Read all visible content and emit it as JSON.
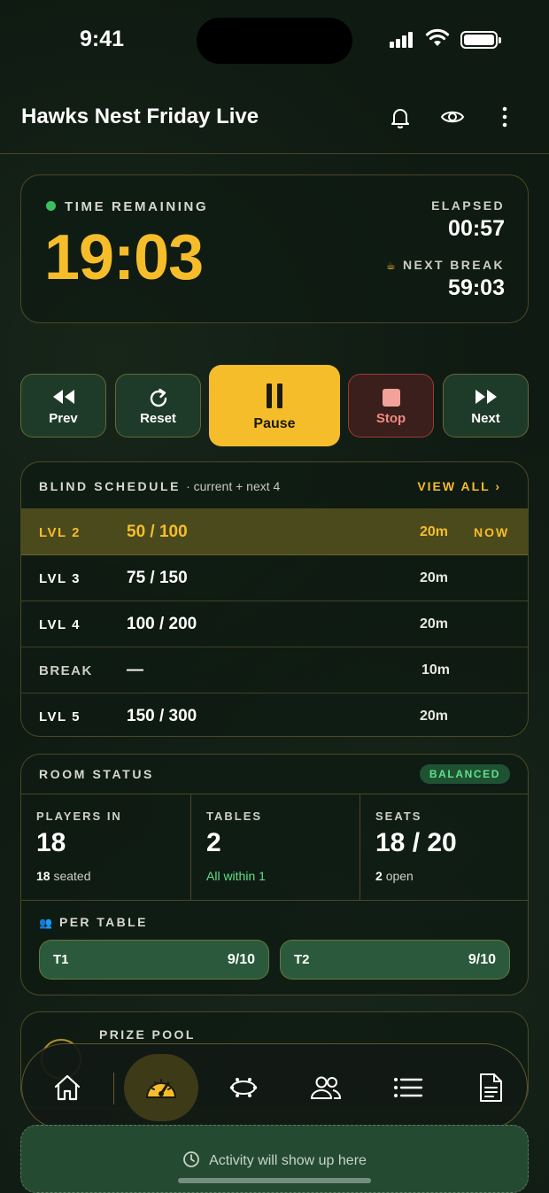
{
  "status_bar": {
    "time": "9:41"
  },
  "header": {
    "title": "Hawks Nest Friday Live"
  },
  "timer": {
    "remaining_label": "TIME REMAINING",
    "remaining": "19:03",
    "elapsed_label": "ELAPSED",
    "elapsed": "00:57",
    "next_break_label": "NEXT BREAK",
    "next_break": "59:03"
  },
  "controls": {
    "prev": "Prev",
    "reset": "Reset",
    "pause": "Pause",
    "stop": "Stop",
    "next": "Next"
  },
  "blind_schedule": {
    "title": "BLIND SCHEDULE",
    "subtitle": "· current + next 4",
    "view_all": "VIEW ALL",
    "rows": [
      {
        "level": "LVL 2",
        "blinds": "50 / 100",
        "duration": "20m",
        "tag": "NOW"
      },
      {
        "level": "LVL 3",
        "blinds": "75 / 150",
        "duration": "20m",
        "tag": ""
      },
      {
        "level": "LVL 4",
        "blinds": "100 / 200",
        "duration": "20m",
        "tag": ""
      },
      {
        "level": "BREAK",
        "blinds": "—",
        "duration": "10m",
        "tag": ""
      },
      {
        "level": "LVL 5",
        "blinds": "150 / 300",
        "duration": "20m",
        "tag": ""
      }
    ]
  },
  "room_status": {
    "title": "ROOM STATUS",
    "badge": "BALANCED",
    "players_label": "PLAYERS IN",
    "players_value": "18",
    "players_sub_num": "18",
    "players_sub_text": "seated",
    "tables_label": "TABLES",
    "tables_value": "2",
    "tables_sub": "All within 1",
    "seats_label": "SEATS",
    "seats_value": "18 / 20",
    "seats_sub_num": "2",
    "seats_sub_text": "open",
    "per_table_label": "PER TABLE",
    "tables": [
      {
        "name": "T1",
        "value": "9/10"
      },
      {
        "name": "T2",
        "value": "9/10"
      }
    ]
  },
  "prize_pool": {
    "label": "PRIZE POOL"
  },
  "tab_bar": {
    "tabs": [
      "home-icon",
      "dashboard-icon",
      "table-icon",
      "players-icon",
      "list-icon",
      "document-icon"
    ],
    "active": "dashboard-icon"
  },
  "activity": {
    "text": "Activity will show up here"
  },
  "colors": {
    "accent": "#f6bd2b",
    "success": "#3ac05c",
    "danger": "#f08a80"
  }
}
